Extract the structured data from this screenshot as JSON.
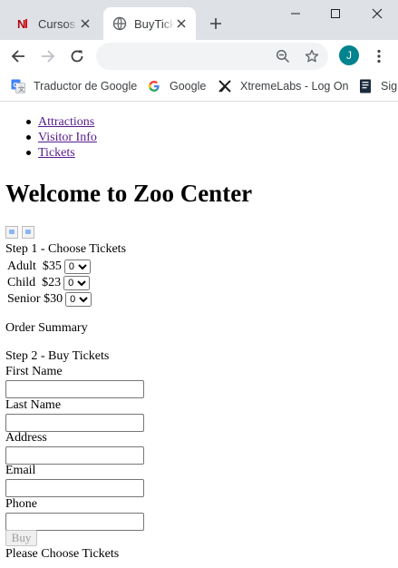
{
  "browser": {
    "tabs": [
      {
        "title": "Cursos de"
      },
      {
        "title": "BuyTickets"
      }
    ],
    "omnibox": {
      "value": ""
    },
    "profile_initial": "J",
    "bookmarks": [
      {
        "label": "Traductor de Google"
      },
      {
        "label": "Google"
      },
      {
        "label": "XtremeLabs - Log On"
      },
      {
        "label": "Sign"
      }
    ]
  },
  "page": {
    "nav": [
      {
        "label": "Attractions"
      },
      {
        "label": "Visitor Info"
      },
      {
        "label": "Tickets"
      }
    ],
    "heading": "Welcome to Zoo Center",
    "step1_label": "Step 1 - Choose Tickets",
    "tickets": [
      {
        "type": "Adult",
        "price": "$35",
        "selected": "0"
      },
      {
        "type": "Child",
        "price": "$23",
        "selected": "0"
      },
      {
        "type": "Senior",
        "price": "$30",
        "selected": "0"
      }
    ],
    "order_summary_label": "Order Summary",
    "step2_label": "Step 2 - Buy Tickets",
    "fields": {
      "first_name": {
        "label": "First Name",
        "value": ""
      },
      "last_name": {
        "label": "Last Name",
        "value": ""
      },
      "address": {
        "label": "Address",
        "value": ""
      },
      "email": {
        "label": "Email",
        "value": ""
      },
      "phone": {
        "label": "Phone",
        "value": ""
      }
    },
    "buy_label": "Buy",
    "status_message": "Please Choose Tickets"
  },
  "colors": {
    "tabstrip": "#dee1e6",
    "link_visited": "#551a8b",
    "avatar": "#00838f"
  }
}
